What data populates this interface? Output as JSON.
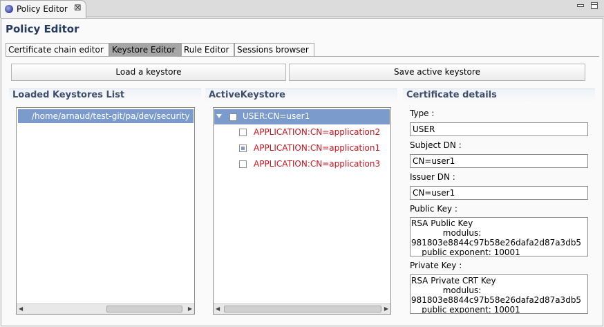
{
  "view": {
    "tab_title": "Policy Editor",
    "close_glyph": "⊠",
    "min_icon": "minimize-icon",
    "max_icon": "maximize-icon"
  },
  "page_title": "Policy Editor",
  "tabs": [
    {
      "label": "Certificate chain editor",
      "selected": false
    },
    {
      "label": "Keystore Editor",
      "selected": true
    },
    {
      "label": "Rule Editor",
      "selected": false
    },
    {
      "label": "Sessions browser",
      "selected": false
    }
  ],
  "buttons": {
    "load": "Load a keystore",
    "save": "Save active keystore"
  },
  "sections": {
    "loaded": "Loaded Keystores List",
    "active": "ActiveKeystore",
    "details": "Certificate details"
  },
  "keystores": [
    {
      "path": "/home/arnaud/test-git/pa/dev/security",
      "selected": true
    }
  ],
  "active_keystore": {
    "root": {
      "label": "USER:CN=user1",
      "checked": false,
      "expanded": true
    },
    "children": [
      {
        "label": "APPLICATION:CN=application2",
        "checked": false
      },
      {
        "label": "APPLICATION:CN=application1",
        "checked": true
      },
      {
        "label": "APPLICATION:CN=application3",
        "checked": false
      }
    ]
  },
  "details": {
    "type_label": "Type :",
    "type_value": "USER",
    "subject_label": "Subject DN :",
    "subject_value": "CN=user1",
    "issuer_label": "Issuer DN :",
    "issuer_value": "CN=user1",
    "public_key_label": "Public Key :",
    "public_key_value": "RSA Public Key\n            modulus:\n981803e8844c97b58e26dafa2d87a3db5\n    public exponent: 10001",
    "private_key_label": "Private Key :",
    "private_key_value": "RSA Private CRT Key\n            modulus:\n981803e8844c97b58e26dafa2d87a3db5\n    public exponent: 10001"
  },
  "colors": {
    "selection": "#7c9bcd",
    "error_text": "#d0121b",
    "title_text": "#243a5e"
  }
}
